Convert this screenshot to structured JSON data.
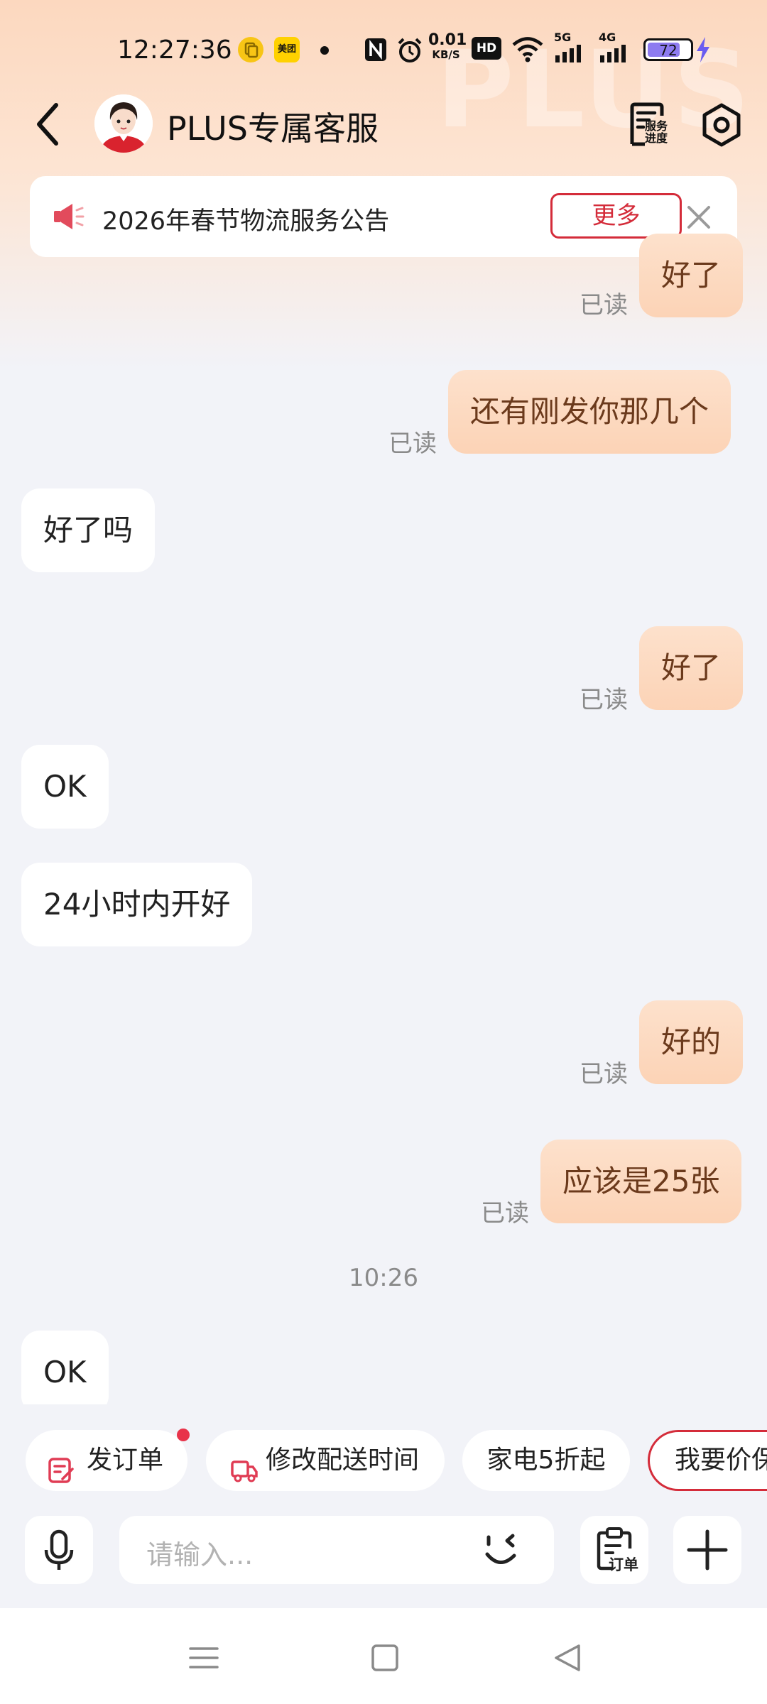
{
  "status_bar": {
    "time": "12:27:36",
    "meituan_label": "美团",
    "net_speed_value": "0.01",
    "net_speed_unit": "KB/S",
    "hd_label": "HD",
    "sim1_label": "5G",
    "sim2_label": "4G",
    "battery": "72"
  },
  "header": {
    "title": "PLUS专属客服",
    "watermark": "PLUS",
    "service_progress_label_1": "服务",
    "service_progress_label_2": "进度"
  },
  "notice": {
    "text": "2026年春节物流服务公告",
    "more_label": "更多"
  },
  "messages": [
    {
      "side": "me",
      "text": "好了",
      "status": "已读"
    },
    {
      "side": "me",
      "text": "还有刚发你那几个",
      "status": "已读"
    },
    {
      "side": "them",
      "text": "好了吗"
    },
    {
      "side": "me",
      "text": "好了",
      "status": "已读"
    },
    {
      "side": "them",
      "text": "OK"
    },
    {
      "side": "them",
      "text": "24小时内开好"
    },
    {
      "side": "me",
      "text": "好的",
      "status": "已读"
    },
    {
      "side": "me",
      "text": "应该是25张",
      "status": "已读"
    },
    {
      "timestamp": "10:26"
    },
    {
      "side": "them",
      "text": "OK"
    }
  ],
  "quick_actions": [
    {
      "label": "发订单",
      "icon": "order-icon",
      "badge": true
    },
    {
      "label": "修改配送时间",
      "icon": "delivery-truck-icon"
    },
    {
      "label": "家电5折起"
    },
    {
      "label": "我要价保"
    }
  ],
  "input_bar": {
    "placeholder": "请输入...",
    "order_button_label": "订单"
  },
  "colors": {
    "accent_red": "#d42c3a",
    "my_bubble": "#fcd3b6",
    "my_text": "#6b3a1c",
    "background": "#f2f3f8"
  }
}
